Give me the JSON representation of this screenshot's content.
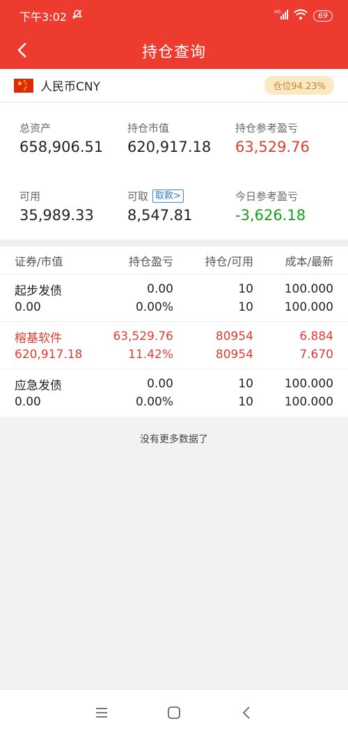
{
  "status_bar": {
    "time": "下午3:02",
    "battery": "69"
  },
  "header": {
    "title": "持仓查询"
  },
  "currency": {
    "name": "人民币CNY",
    "position_ratio": "仓位94.23%"
  },
  "summary": {
    "total_assets_label": "总资产",
    "total_assets": "658,906.51",
    "market_value_label": "持仓市值",
    "market_value": "620,917.18",
    "pnl_label": "持仓参考盈亏",
    "pnl": "63,529.76",
    "available_label": "可用",
    "available": "35,989.33",
    "withdrawable_label": "可取",
    "withdrawable": "8,547.81",
    "withdraw_link": "取款>",
    "today_pnl_label": "今日参考盈亏",
    "today_pnl": "-3,626.18"
  },
  "table": {
    "headers": [
      "证券/市值",
      "持仓盈亏",
      "持仓/可用",
      "成本/最新"
    ],
    "rows": [
      {
        "name": "起步发债",
        "value": "0.00",
        "pnl": "0.00",
        "pnl_pct": "0.00%",
        "hold": "10",
        "avail": "10",
        "cost": "100.000",
        "latest": "100.000"
      },
      {
        "name": "榕基软件",
        "value": "620,917.18",
        "pnl": "63,529.76",
        "pnl_pct": "11.42%",
        "hold": "80954",
        "avail": "80954",
        "cost": "6.884",
        "latest": "7.670"
      },
      {
        "name": "应急发债",
        "value": "0.00",
        "pnl": "0.00",
        "pnl_pct": "0.00%",
        "hold": "10",
        "avail": "10",
        "cost": "100.000",
        "latest": "100.000"
      }
    ]
  },
  "footer_text": "没有更多数据了",
  "colors": {
    "brand": "#ee3b2f",
    "profit": "#e03c31",
    "loss": "#14a01a"
  },
  "icons": [
    "back-arrow-icon",
    "mute-icon",
    "signal-icon",
    "wifi-icon",
    "menu-icon",
    "home-icon",
    "back-icon"
  ]
}
